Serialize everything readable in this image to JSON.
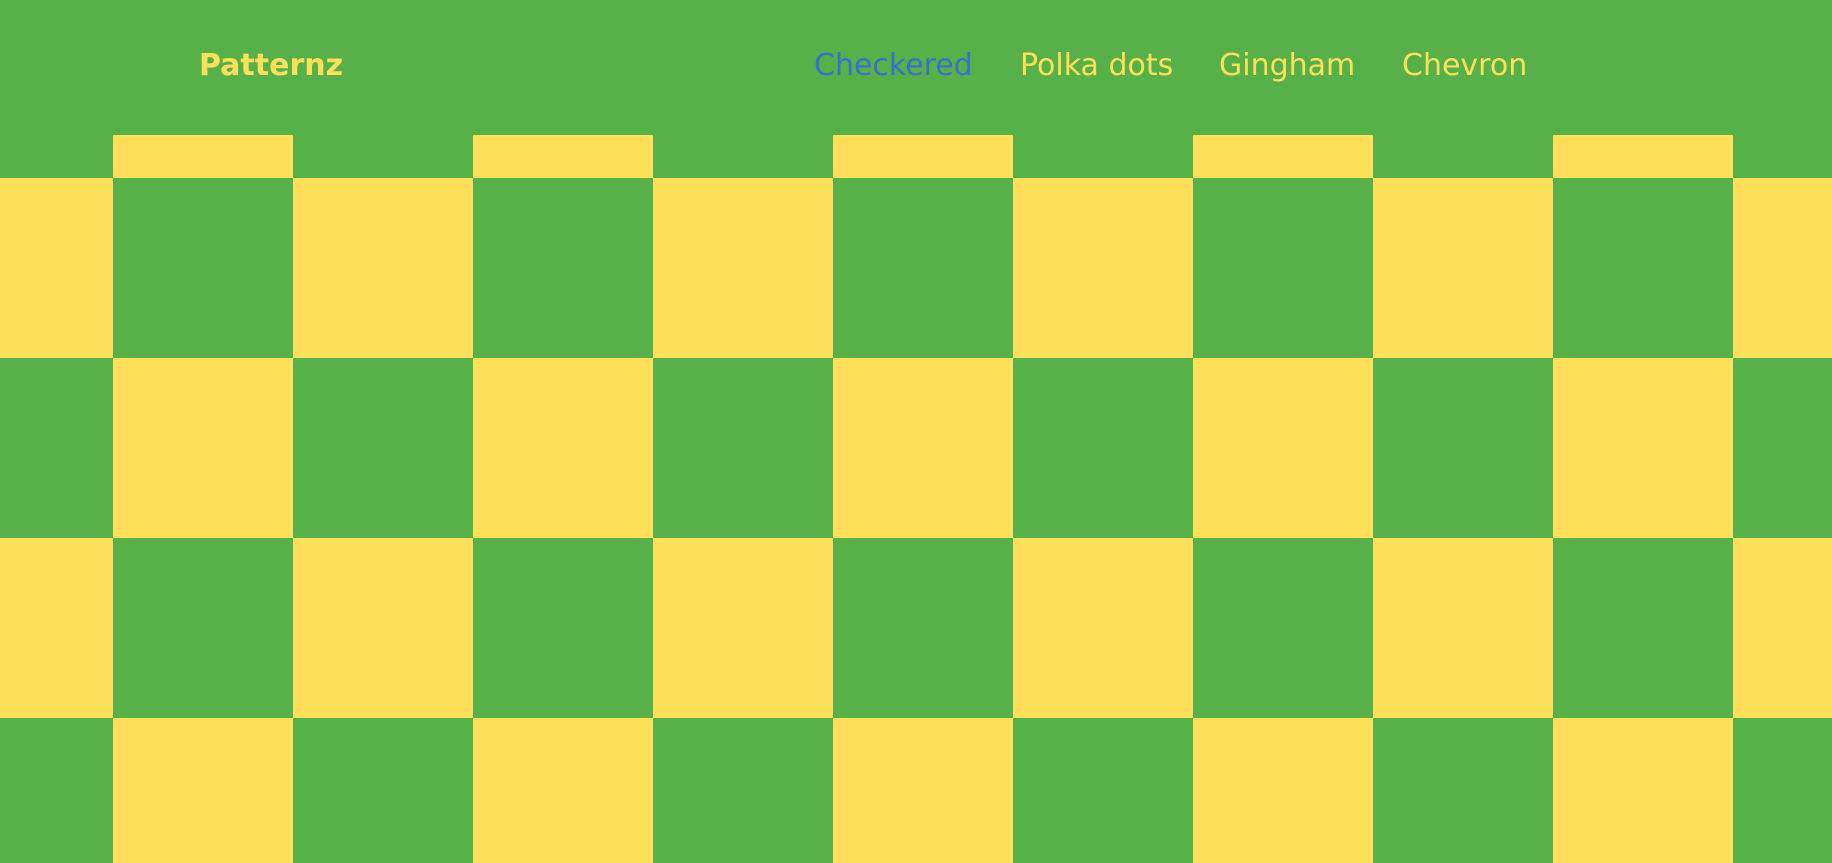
{
  "site": {
    "logo": "Patternz"
  },
  "nav": {
    "items": [
      {
        "label": "Checkered",
        "active": true
      },
      {
        "label": "Polka dots",
        "active": false
      },
      {
        "label": "Gingham",
        "active": false
      },
      {
        "label": "Chevron",
        "active": false
      }
    ]
  },
  "colors": {
    "background_green": "#57b148",
    "accent_yellow": "#ffe05a",
    "active_link_blue": "#3b6fc9"
  }
}
